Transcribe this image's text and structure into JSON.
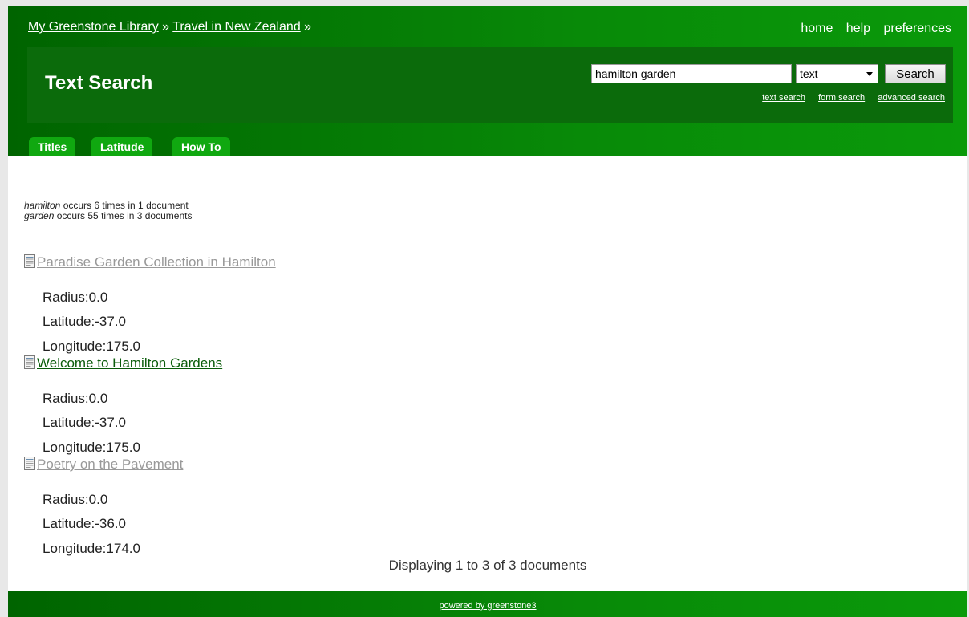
{
  "breadcrumb": {
    "library": "My Greenstone Library",
    "sep1": " » ",
    "collection": "Travel in New Zealand",
    "sep2": " »"
  },
  "quicklinks": [
    "home",
    "help",
    "preferences"
  ],
  "page_title": "Text Search",
  "search": {
    "query": "hamilton garden",
    "field_selected": "text",
    "button_label": "Search",
    "links": [
      "text search",
      "form search",
      "advanced search"
    ]
  },
  "tabs": [
    "Titles",
    "Latitude",
    "How To"
  ],
  "term_info": [
    {
      "term": "hamilton",
      "text": " occurs 6 times in 1 document"
    },
    {
      "term": "garden",
      "text": " occurs 55 times in 3 documents"
    }
  ],
  "results": [
    {
      "title": "Paradise Garden Collection in Hamilton",
      "link_color": "#999999",
      "radius": "Radius:0.0",
      "latitude": "Latitude:-37.0",
      "longitude": "Longitude:175.0"
    },
    {
      "title": "Welcome to Hamilton Gardens",
      "link_color": "#0a5c0a",
      "radius": "Radius:0.0",
      "latitude": "Latitude:-37.0",
      "longitude": "Longitude:175.0"
    },
    {
      "title": "Poetry on the Pavement",
      "link_color": "#999999",
      "radius": "Radius:0.0",
      "latitude": "Latitude:-36.0",
      "longitude": "Longitude:174.0"
    }
  ],
  "displaying": "Displaying 1 to 3 of 3 documents",
  "footer": "powered by greenstone3",
  "colors": {
    "header_dark": "#006400",
    "header_light": "#0a9a0a",
    "tab": "#10a810"
  },
  "icons": [
    "document-icon"
  ]
}
